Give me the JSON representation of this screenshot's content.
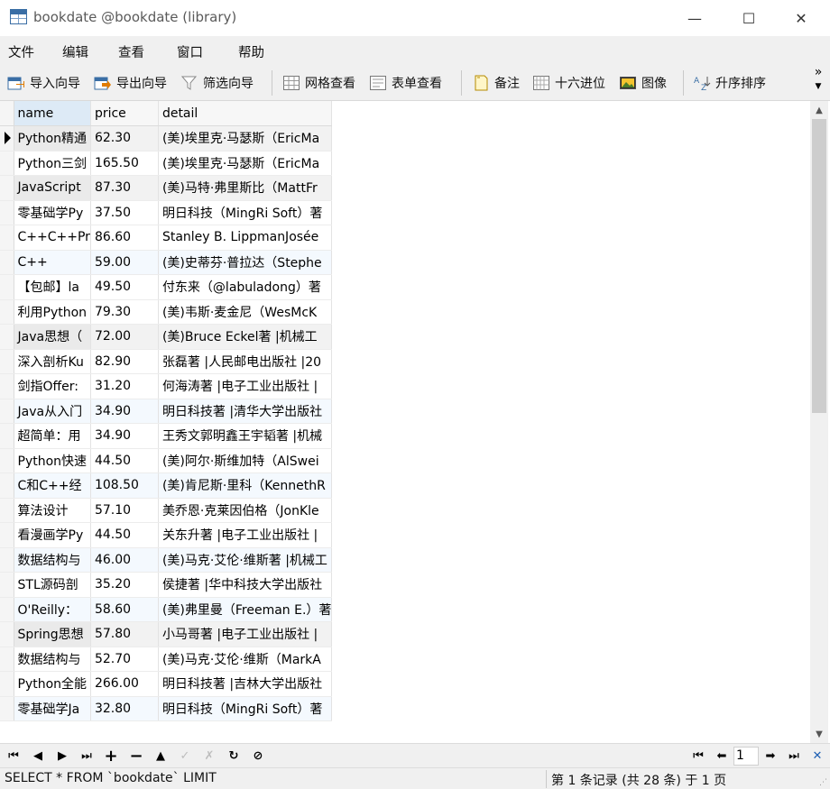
{
  "window": {
    "title": "bookdate @bookdate (library)",
    "minimize_glyph": "—",
    "maximize_glyph": "☐",
    "close_glyph": "✕"
  },
  "menu": [
    "文件",
    "编辑",
    "查看",
    "窗口",
    "帮助"
  ],
  "toolbar": {
    "import_label": "导入向导",
    "export_label": "导出向导",
    "filter_label": "筛选向导",
    "grid_view_label": "网格查看",
    "form_view_label": "表单查看",
    "memo_label": "备注",
    "hex_label": "十六进位",
    "image_label": "图像",
    "sort_label": "升序排序",
    "more_glyph": "»"
  },
  "grid": {
    "columns": [
      "name",
      "price",
      "detail"
    ],
    "rows": [
      {
        "name": "Python精通",
        "price": "62.30",
        "detail": "(美)埃里克·马瑟斯（EricMa"
      },
      {
        "name": "Python三剑",
        "price": "165.50",
        "detail": "(美)埃里克·马瑟斯（EricMa"
      },
      {
        "name": "JavaScript",
        "price": "87.30",
        "detail": "(美)马特·弗里斯比（MattFr"
      },
      {
        "name": "零基础学Py",
        "price": "37.50",
        "detail": "明日科技（MingRi Soft）著"
      },
      {
        "name": "C++C++Pr",
        "price": "86.60",
        "detail": "Stanley B. LippmanJosée"
      },
      {
        "name": "C++",
        "price": "59.00",
        "detail": "(美)史蒂芬·普拉达（Stephe"
      },
      {
        "name": "【包邮】la",
        "price": "49.50",
        "detail": "付东来（@labuladong）著"
      },
      {
        "name": "利用Python",
        "price": "79.30",
        "detail": "(美)韦斯·麦金尼（WesMcK"
      },
      {
        "name": "Java思想（",
        "price": "72.00",
        "detail": "(美)Bruce  Eckel著 |机械工"
      },
      {
        "name": "深入剖析Ku",
        "price": "82.90",
        "detail": "张磊著 |人民邮电出版社 |20"
      },
      {
        "name": "剑指Offer:",
        "price": "31.20",
        "detail": "何海涛著 |电子工业出版社 |"
      },
      {
        "name": "Java从入门",
        "price": "34.90",
        "detail": "明日科技著 |清华大学出版社"
      },
      {
        "name": "超简单：用",
        "price": "34.90",
        "detail": "王秀文郭明鑫王宇韬著 |机械"
      },
      {
        "name": "Python快速",
        "price": "44.50",
        "detail": "(美)阿尔·斯维加特（AlSwei"
      },
      {
        "name": "C和C++经",
        "price": "108.50",
        "detail": "(美)肯尼斯·里科（KennethR"
      },
      {
        "name": "算法设计",
        "price": "57.10",
        "detail": "美乔恩·克莱因伯格（JonKle"
      },
      {
        "name": "看漫画学Py",
        "price": "44.50",
        "detail": "关东升著 |电子工业出版社 |"
      },
      {
        "name": "数据结构与",
        "price": "46.00",
        "detail": "(美)马克·艾伦·维斯著 |机械工"
      },
      {
        "name": "STL源码剖",
        "price": "35.20",
        "detail": "侯捷著 |华中科技大学出版社"
      },
      {
        "name": "O'Reilly：",
        "price": "58.60",
        "detail": "(美)弗里曼（Freeman E.）著"
      },
      {
        "name": "Spring思想",
        "price": "57.80",
        "detail": "小马哥著 |电子工业出版社 |"
      },
      {
        "name": "数据结构与",
        "price": "52.70",
        "detail": "(美)马克·艾伦·维斯（MarkA"
      },
      {
        "name": "Python全能",
        "price": "266.00",
        "detail": "明日科技著 |吉林大学出版社"
      },
      {
        "name": "零基础学Ja",
        "price": "32.80",
        "detail": "明日科技（MingRi Soft）著"
      }
    ]
  },
  "navigation": {
    "first_glyph": "⏮",
    "prev_glyph": "◀",
    "next_glyph": "▶",
    "last_glyph": "⏭",
    "add_glyph": "+",
    "delete_glyph": "−",
    "up_glyph": "▲",
    "apply_glyph": "✓",
    "cancel_glyph": "✗",
    "refresh_glyph": "↻",
    "stop_glyph": "⊘",
    "page_first_glyph": "⏮",
    "page_prev_glyph": "⬅",
    "page_number": "1",
    "page_next_glyph": "➡",
    "page_last_glyph": "⏭",
    "settings_glyph": "✕"
  },
  "status": {
    "sql": "SELECT * FROM `bookdate` LIMIT",
    "record_info": "第 1 条记录 (共 28 条) 于 1 页"
  },
  "colors": {
    "selected_header": "#ddeaf6",
    "alt_row": "#f4f9fe",
    "toolbar_bg": "#f0f0f0"
  }
}
